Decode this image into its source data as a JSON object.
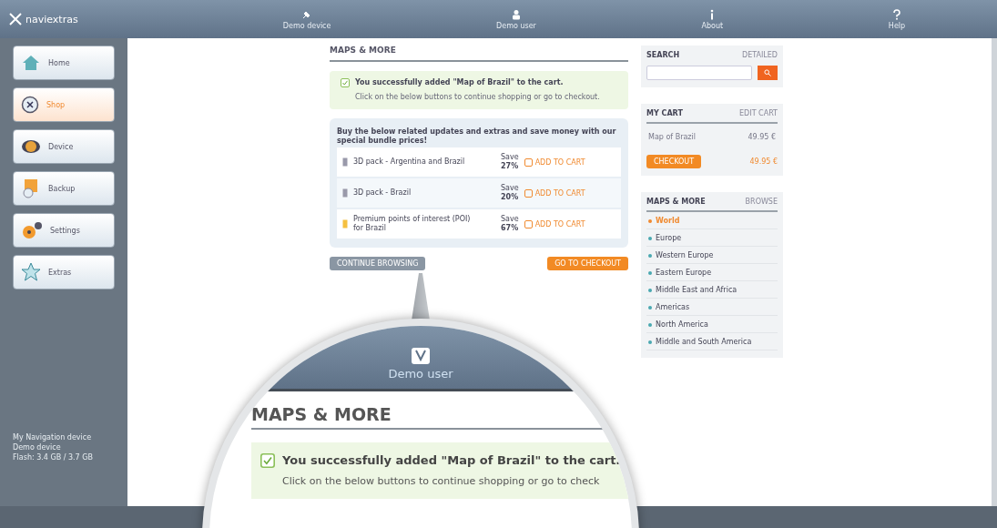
{
  "topbar": {
    "logo": "naviextras",
    "nav": [
      {
        "label": "Demo device"
      },
      {
        "label": "Demo user"
      },
      {
        "label": "About"
      },
      {
        "label": "Help"
      }
    ]
  },
  "sidebar": {
    "items": [
      {
        "label": "Home",
        "selected": false
      },
      {
        "label": "Shop",
        "selected": true
      },
      {
        "label": "Device",
        "selected": false
      },
      {
        "label": "Backup",
        "selected": false
      },
      {
        "label": "Settings",
        "selected": false
      },
      {
        "label": "Extras",
        "selected": false
      }
    ],
    "device_info": [
      "My Navigation device",
      "Demo device",
      "Flash: 3.4 GB / 3.7 GB"
    ]
  },
  "content": {
    "heading": "MAPS & MORE",
    "notice": {
      "title": "You successfully added \"Map of Brazil\" to the cart.",
      "text": "Click on the below buttons to continue shopping or go to checkout."
    },
    "bundle": {
      "intro": "Buy the below related updates and extras and save money with our special bundle prices!",
      "rows": [
        {
          "name": "3D pack - Argentina and Brazil",
          "save_label": "Save",
          "save_value": "27%",
          "button": "ADD TO CART"
        },
        {
          "name": "3D pack - Brazil",
          "save_label": "Save",
          "save_value": "20%",
          "button": "ADD TO CART"
        },
        {
          "name": "Premium points of interest (POI) for Brazil",
          "save_label": "Save",
          "save_value": "67%",
          "button": "ADD TO CART"
        }
      ]
    },
    "continue_button": "CONTINUE BROWSING",
    "checkout_button": "GO TO CHECKOUT"
  },
  "right": {
    "search": {
      "title": "SEARCH",
      "link": "DETAILED"
    },
    "cart": {
      "title": "MY CART",
      "link": "EDIT CART",
      "items": [
        {
          "name": "Map of Brazil",
          "price": "49.95 €"
        }
      ],
      "checkout_button": "CHECKOUT",
      "total": "49.95 €"
    },
    "categories": {
      "title": "MAPS & MORE",
      "link": "BROWSE",
      "items": [
        {
          "name": "World",
          "selected": true
        },
        {
          "name": "Europe",
          "selected": false
        },
        {
          "name": "Western Europe",
          "selected": false
        },
        {
          "name": "Eastern Europe",
          "selected": false
        },
        {
          "name": "Middle East and Africa",
          "selected": false
        },
        {
          "name": "Americas",
          "selected": false
        },
        {
          "name": "North America",
          "selected": false
        },
        {
          "name": "Middle and South America",
          "selected": false
        }
      ]
    }
  },
  "magnifier": {
    "user_label": "Demo user",
    "heading": "MAPS & MORE",
    "notice_title": "You successfully added \"Map of Brazil\" to the cart.",
    "notice_text": "Click on the below buttons to continue shopping or go to check"
  }
}
